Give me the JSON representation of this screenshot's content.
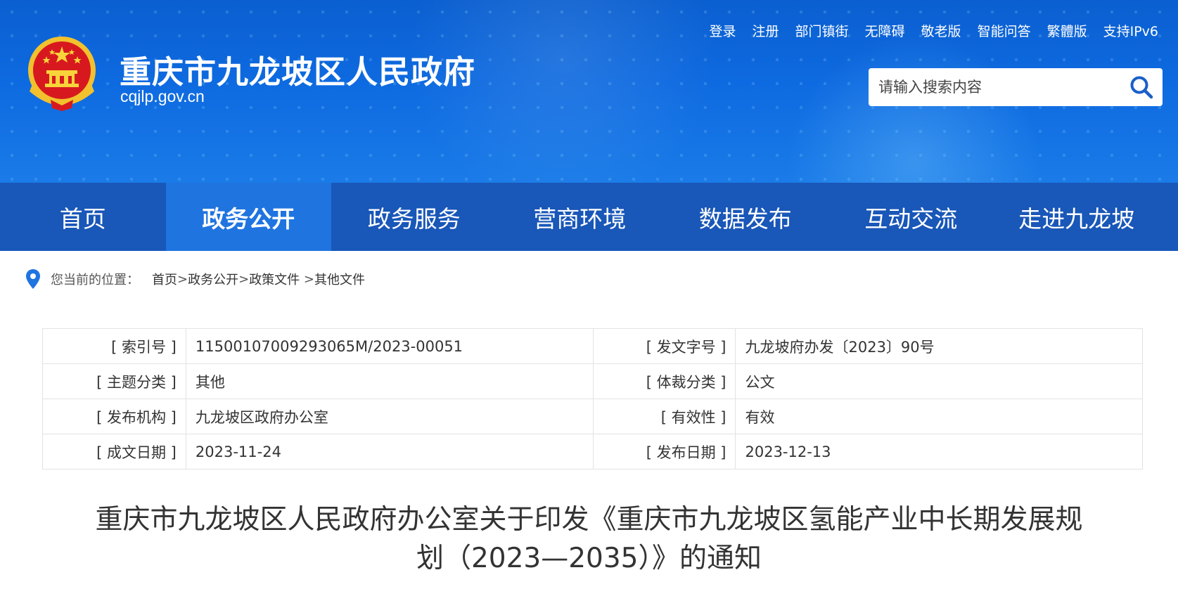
{
  "header": {
    "site_title": "重庆市九龙坡区人民政府",
    "site_domain": "cqjlp.gov.cn",
    "top_links": [
      "登录",
      "注册",
      "部门镇街",
      "无障碍",
      "敬老版",
      "智能问答",
      "繁體版",
      "支持IPv6"
    ],
    "search_placeholder": "请输入搜索内容"
  },
  "nav": {
    "items": [
      "首页",
      "政务公开",
      "政务服务",
      "营商环境",
      "数据发布",
      "互动交流",
      "走进九龙坡"
    ],
    "active": "政务公开"
  },
  "breadcrumb": {
    "prefix": "您当前的位置：",
    "crumbs": [
      "首页",
      "政务公开",
      "政策文件",
      "其他文件"
    ],
    "separators": [
      ">",
      ">",
      " >"
    ]
  },
  "meta": {
    "rows": [
      {
        "k1": "[ 索引号 ]",
        "v1": "11500107009293065M/2023-00051",
        "k2": "[ 发文字号 ]",
        "v2": "九龙坡府办发〔2023〕90号"
      },
      {
        "k1": "[ 主题分类 ]",
        "v1": "其他",
        "k2": "[ 体裁分类 ]",
        "v2": "公文"
      },
      {
        "k1": "[ 发布机构 ]",
        "v1": "九龙坡区政府办公室",
        "k2": "[ 有效性 ]",
        "v2": "有效"
      },
      {
        "k1": "[ 成文日期 ]",
        "v1": "2023-11-24",
        "k2": "[ 发布日期 ]",
        "v2": "2023-12-13"
      }
    ]
  },
  "document": {
    "title_line1": "重庆市九龙坡区人民政府办公室关于印发《重庆市九龙坡区氢能产业中长期发展规",
    "title_line2": "划（2023—2035）》的通知"
  },
  "colors": {
    "header_blue": "#0e6ae0",
    "nav_blue": "#1957b8",
    "nav_active": "#1f74e0",
    "search_icon": "#1a5fc8",
    "emblem_red": "#d7191f",
    "emblem_gold": "#f2c12e"
  },
  "icons": {
    "emblem": "national-emblem-icon",
    "search": "search-icon",
    "location": "location-pin-icon"
  }
}
